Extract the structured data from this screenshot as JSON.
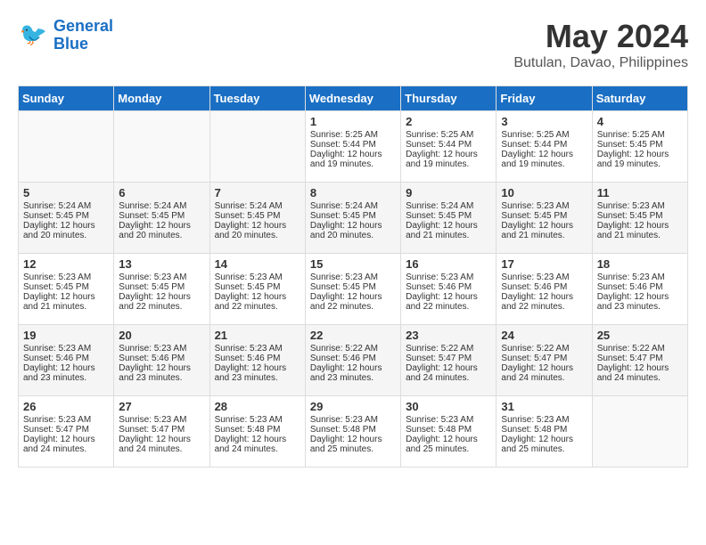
{
  "header": {
    "logo_line1": "General",
    "logo_line2": "Blue",
    "month_year": "May 2024",
    "location": "Butulan, Davao, Philippines"
  },
  "days_of_week": [
    "Sunday",
    "Monday",
    "Tuesday",
    "Wednesday",
    "Thursday",
    "Friday",
    "Saturday"
  ],
  "weeks": [
    [
      {
        "day": "",
        "info": ""
      },
      {
        "day": "",
        "info": ""
      },
      {
        "day": "",
        "info": ""
      },
      {
        "day": "1",
        "info": "Sunrise: 5:25 AM\nSunset: 5:44 PM\nDaylight: 12 hours\nand 19 minutes."
      },
      {
        "day": "2",
        "info": "Sunrise: 5:25 AM\nSunset: 5:44 PM\nDaylight: 12 hours\nand 19 minutes."
      },
      {
        "day": "3",
        "info": "Sunrise: 5:25 AM\nSunset: 5:44 PM\nDaylight: 12 hours\nand 19 minutes."
      },
      {
        "day": "4",
        "info": "Sunrise: 5:25 AM\nSunset: 5:45 PM\nDaylight: 12 hours\nand 19 minutes."
      }
    ],
    [
      {
        "day": "5",
        "info": "Sunrise: 5:24 AM\nSunset: 5:45 PM\nDaylight: 12 hours\nand 20 minutes."
      },
      {
        "day": "6",
        "info": "Sunrise: 5:24 AM\nSunset: 5:45 PM\nDaylight: 12 hours\nand 20 minutes."
      },
      {
        "day": "7",
        "info": "Sunrise: 5:24 AM\nSunset: 5:45 PM\nDaylight: 12 hours\nand 20 minutes."
      },
      {
        "day": "8",
        "info": "Sunrise: 5:24 AM\nSunset: 5:45 PM\nDaylight: 12 hours\nand 20 minutes."
      },
      {
        "day": "9",
        "info": "Sunrise: 5:24 AM\nSunset: 5:45 PM\nDaylight: 12 hours\nand 21 minutes."
      },
      {
        "day": "10",
        "info": "Sunrise: 5:23 AM\nSunset: 5:45 PM\nDaylight: 12 hours\nand 21 minutes."
      },
      {
        "day": "11",
        "info": "Sunrise: 5:23 AM\nSunset: 5:45 PM\nDaylight: 12 hours\nand 21 minutes."
      }
    ],
    [
      {
        "day": "12",
        "info": "Sunrise: 5:23 AM\nSunset: 5:45 PM\nDaylight: 12 hours\nand 21 minutes."
      },
      {
        "day": "13",
        "info": "Sunrise: 5:23 AM\nSunset: 5:45 PM\nDaylight: 12 hours\nand 22 minutes."
      },
      {
        "day": "14",
        "info": "Sunrise: 5:23 AM\nSunset: 5:45 PM\nDaylight: 12 hours\nand 22 minutes."
      },
      {
        "day": "15",
        "info": "Sunrise: 5:23 AM\nSunset: 5:45 PM\nDaylight: 12 hours\nand 22 minutes."
      },
      {
        "day": "16",
        "info": "Sunrise: 5:23 AM\nSunset: 5:46 PM\nDaylight: 12 hours\nand 22 minutes."
      },
      {
        "day": "17",
        "info": "Sunrise: 5:23 AM\nSunset: 5:46 PM\nDaylight: 12 hours\nand 22 minutes."
      },
      {
        "day": "18",
        "info": "Sunrise: 5:23 AM\nSunset: 5:46 PM\nDaylight: 12 hours\nand 23 minutes."
      }
    ],
    [
      {
        "day": "19",
        "info": "Sunrise: 5:23 AM\nSunset: 5:46 PM\nDaylight: 12 hours\nand 23 minutes."
      },
      {
        "day": "20",
        "info": "Sunrise: 5:23 AM\nSunset: 5:46 PM\nDaylight: 12 hours\nand 23 minutes."
      },
      {
        "day": "21",
        "info": "Sunrise: 5:23 AM\nSunset: 5:46 PM\nDaylight: 12 hours\nand 23 minutes."
      },
      {
        "day": "22",
        "info": "Sunrise: 5:22 AM\nSunset: 5:46 PM\nDaylight: 12 hours\nand 23 minutes."
      },
      {
        "day": "23",
        "info": "Sunrise: 5:22 AM\nSunset: 5:47 PM\nDaylight: 12 hours\nand 24 minutes."
      },
      {
        "day": "24",
        "info": "Sunrise: 5:22 AM\nSunset: 5:47 PM\nDaylight: 12 hours\nand 24 minutes."
      },
      {
        "day": "25",
        "info": "Sunrise: 5:22 AM\nSunset: 5:47 PM\nDaylight: 12 hours\nand 24 minutes."
      }
    ],
    [
      {
        "day": "26",
        "info": "Sunrise: 5:23 AM\nSunset: 5:47 PM\nDaylight: 12 hours\nand 24 minutes."
      },
      {
        "day": "27",
        "info": "Sunrise: 5:23 AM\nSunset: 5:47 PM\nDaylight: 12 hours\nand 24 minutes."
      },
      {
        "day": "28",
        "info": "Sunrise: 5:23 AM\nSunset: 5:48 PM\nDaylight: 12 hours\nand 24 minutes."
      },
      {
        "day": "29",
        "info": "Sunrise: 5:23 AM\nSunset: 5:48 PM\nDaylight: 12 hours\nand 25 minutes."
      },
      {
        "day": "30",
        "info": "Sunrise: 5:23 AM\nSunset: 5:48 PM\nDaylight: 12 hours\nand 25 minutes."
      },
      {
        "day": "31",
        "info": "Sunrise: 5:23 AM\nSunset: 5:48 PM\nDaylight: 12 hours\nand 25 minutes."
      },
      {
        "day": "",
        "info": ""
      }
    ]
  ]
}
